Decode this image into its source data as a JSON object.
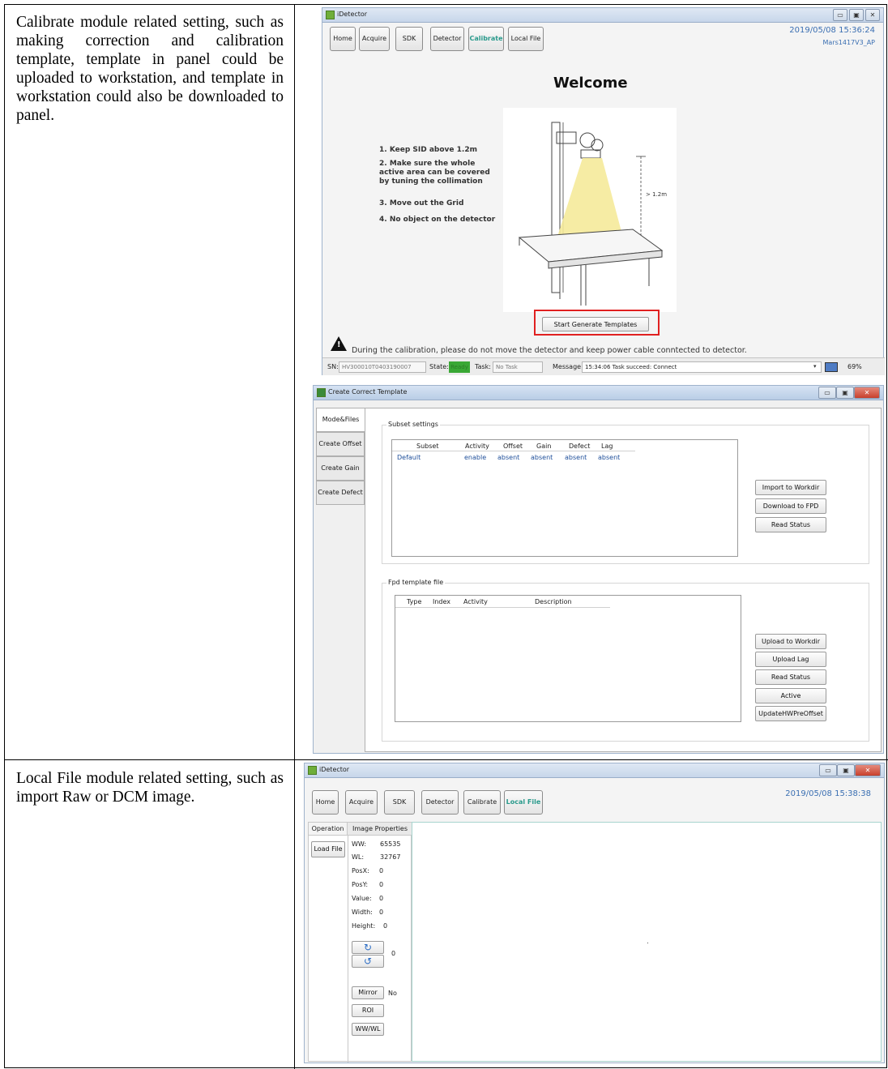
{
  "rows": [
    {
      "description": "Calibrate module related setting, such as making correction and calibration template, template in panel could be uploaded to workstation, and template in workstation could also be downloaded to panel."
    },
    {
      "description": "Local File module related setting, such as import Raw or DCM image."
    }
  ],
  "calibrate_screen": {
    "window_title": "iDetector",
    "nav": [
      "Home",
      "Acquire",
      "SDK",
      "Detector",
      "Calibrate",
      "Local File"
    ],
    "active_tab": "Calibrate",
    "datetime": "2019/05/08 15:36:24",
    "model": "Mars1417V3_AP",
    "heading": "Welcome",
    "steps": [
      "1. Keep SID above 1.2m",
      "2. Make sure the whole active area can be covered by tuning the collimation",
      "3. Move out the Grid",
      "4. No object on the detector"
    ],
    "distance_label": "> 1.2m",
    "start_button": "Start Generate Templates",
    "warning": "During the calibration, please do not move the detector and keep power cable conntected to detector.",
    "status": {
      "sn_label": "SN:",
      "sn_value": "HV300010T0403190007",
      "state_label": "State:",
      "state_value": "Ready",
      "task_label": "Task:",
      "task_value": "No Task",
      "message_label": "Message:",
      "message_value": "15:34:06 Task succeed: Connect",
      "zoom": "69%"
    },
    "colors": {
      "accent": "#2a9a8c",
      "date_text": "#3b6fb2",
      "state_ready": "#3aa835",
      "highlight_box": "#e02020"
    }
  },
  "template_dialog": {
    "title": "Create Correct Template",
    "tabs": [
      "Mode&Files",
      "Create Offset",
      "Create Gain",
      "Create Defect"
    ],
    "subset_group": "Subset settings",
    "subset_columns": [
      "Subset",
      "Activity",
      "Offset",
      "Gain",
      "Defect",
      "Lag"
    ],
    "subset_rows": [
      [
        "Default",
        "enable",
        "absent",
        "absent",
        "absent",
        "absent"
      ]
    ],
    "subset_buttons": [
      "Import to Workdir",
      "Download to FPD",
      "Read Status"
    ],
    "fpd_group": "Fpd template file",
    "fpd_columns": [
      "Type",
      "Index",
      "Activity",
      "Description"
    ],
    "fpd_buttons": [
      "Upload to Workdir",
      "Upload Lag",
      "Read Status",
      "Active",
      "UpdateHWPreOffset"
    ]
  },
  "localfile_screen": {
    "window_title": "iDetector",
    "nav": [
      "Home",
      "Acquire",
      "SDK",
      "Detector",
      "Calibrate",
      "Local File"
    ],
    "active_tab": "Local File",
    "datetime": "2019/05/08 15:38:38",
    "panel_tabs": [
      "Operation",
      "Image Properties"
    ],
    "load_button": "Load File",
    "properties": [
      {
        "label": "WW:",
        "value": "65535"
      },
      {
        "label": "WL:",
        "value": "32767"
      },
      {
        "label": "PosX:",
        "value": "0"
      },
      {
        "label": "PosY:",
        "value": "0"
      },
      {
        "label": "Value:",
        "value": "0"
      },
      {
        "label": "Width:",
        "value": "0"
      },
      {
        "label": "Height:",
        "value": "0"
      }
    ],
    "rotation_value": "0",
    "mirror_button": "Mirror",
    "mirror_value": "No",
    "roi_button": "ROI",
    "wwwl_button": "WW/WL"
  }
}
